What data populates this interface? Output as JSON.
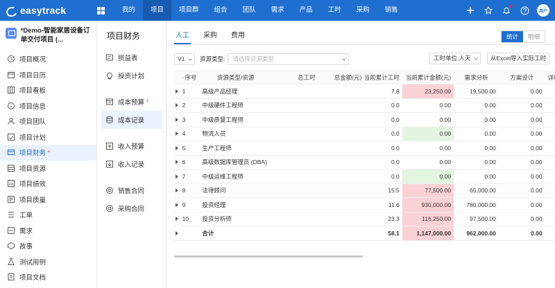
{
  "app": {
    "name": "easytrack"
  },
  "topnav": [
    "我的",
    "项目",
    "项目群",
    "组合",
    "团队",
    "需求",
    "产品",
    "工时",
    "采购",
    "销售"
  ],
  "user": {
    "avatar_text": "用户"
  },
  "project": {
    "name": "*Demo-智能家居设备订单交付项目 (..."
  },
  "sidebar": [
    {
      "label": "项目概况",
      "icon": "clock-icon"
    },
    {
      "label": "项目日历",
      "icon": "calendar-icon"
    },
    {
      "label": "项目看板",
      "icon": "board-icon"
    },
    {
      "label": "项目信息",
      "icon": "info-icon"
    },
    {
      "label": "项目团队",
      "icon": "team-icon"
    },
    {
      "label": "项目计划",
      "icon": "plan-icon"
    },
    {
      "label": "项目财务",
      "icon": "finance-icon",
      "active": true,
      "starred": true
    },
    {
      "label": "项目资源",
      "icon": "resource-icon"
    },
    {
      "label": "项目绩效",
      "icon": "performance-icon"
    },
    {
      "label": "项目质量",
      "icon": "quality-icon"
    },
    {
      "label": "工单",
      "icon": "ticket-icon"
    },
    {
      "label": "需求",
      "icon": "requirement-icon"
    },
    {
      "label": "故事",
      "icon": "story-icon"
    },
    {
      "label": "测试用例",
      "icon": "test-icon"
    },
    {
      "label": "项目文档",
      "icon": "document-icon"
    }
  ],
  "finance": {
    "title": "项目财务",
    "items": [
      {
        "label": "损益表",
        "icon": "pl-icon"
      },
      {
        "label": "投资计划",
        "icon": "bulb-icon"
      },
      {
        "label": "成本预算",
        "icon": "budget-icon",
        "starred": true
      },
      {
        "label": "成本记录",
        "icon": "database-icon",
        "active": true
      },
      {
        "label": "收入预算",
        "icon": "income-budget-icon"
      },
      {
        "label": "收入记录",
        "icon": "income-record-icon"
      },
      {
        "label": "销售合同",
        "icon": "sales-contract-icon"
      },
      {
        "label": "采购合同",
        "icon": "purchase-contract-icon"
      }
    ]
  },
  "tabs": [
    "人工",
    "采购",
    "费用"
  ],
  "mode": {
    "stat": "统计",
    "detail": "明细"
  },
  "filters": {
    "version": "V1",
    "type_label": "资源类型:",
    "type_placeholder": "请选择资源类型",
    "unit": "工时单位:人天",
    "import": "从Excel导入实际工时"
  },
  "table": {
    "headers": {
      "no": "序号",
      "name": "资源类型/资源",
      "total": "总工时",
      "amount": "总金额(元)",
      "cur": "当前累计工时",
      "cur_amount": "当前累计金额(元)",
      "req": "需求分析",
      "plan": "方案设计",
      "detail": "详细"
    },
    "rows": [
      {
        "no": "1",
        "name": "高级产品经理",
        "total": "",
        "amount": "",
        "cur": "7.8",
        "cur_amount": "23,250.00",
        "req": "19,500.00",
        "plan": "0.00",
        "hl": "pink"
      },
      {
        "no": "2",
        "name": "中级硬件工程师",
        "total": "",
        "amount": "",
        "cur": "0.0",
        "cur_amount": "0.00",
        "req": "0.00",
        "plan": "0.00",
        "hl": ""
      },
      {
        "no": "3",
        "name": "中级质量工程师",
        "total": "",
        "amount": "",
        "cur": "0.0",
        "cur_amount": "0.00",
        "req": "0.00",
        "plan": "0.00",
        "hl": ""
      },
      {
        "no": "4",
        "name": "物流人员",
        "total": "",
        "amount": "",
        "cur": "0.0",
        "cur_amount": "0.00",
        "req": "0.00",
        "plan": "0.00",
        "hl": "green"
      },
      {
        "no": "5",
        "name": "生产工程师",
        "total": "",
        "amount": "",
        "cur": "0.0",
        "cur_amount": "0.00",
        "req": "0.00",
        "plan": "0.00",
        "hl": ""
      },
      {
        "no": "6",
        "name": "高级数据库管理员 (DBA)",
        "total": "",
        "amount": "",
        "cur": "0.0",
        "cur_amount": "0.00",
        "req": "0.00",
        "plan": "0.00",
        "hl": ""
      },
      {
        "no": "7",
        "name": "中级运维工程师",
        "total": "",
        "amount": "",
        "cur": "0.0",
        "cur_amount": "0.00",
        "req": "0.00",
        "plan": "0.00",
        "hl": "green"
      },
      {
        "no": "8",
        "name": "法律顾问",
        "total": "",
        "amount": "",
        "cur": "15.5",
        "cur_amount": "77,500.00",
        "req": "65,000.00",
        "plan": "0.00",
        "hl": "pink"
      },
      {
        "no": "9",
        "name": "投资经理",
        "total": "",
        "amount": "",
        "cur": "11.6",
        "cur_amount": "930,000.00",
        "req": "780,000.00",
        "plan": "0.00",
        "hl": "pink"
      },
      {
        "no": "10",
        "name": "投资分析师",
        "total": "",
        "amount": "",
        "cur": "23.3",
        "cur_amount": "116,250.00",
        "req": "97,500.00",
        "plan": "0.00",
        "hl": "pink"
      }
    ],
    "total": {
      "label": "合计",
      "cur": "58.1",
      "cur_amount": "1,147,000.00",
      "req": "962,000.00",
      "plan": "0.00"
    }
  },
  "colors": {
    "primary": "#1f6fd0",
    "pink_cell": "#fbd1d6",
    "green_cell": "#e3f5e1"
  }
}
